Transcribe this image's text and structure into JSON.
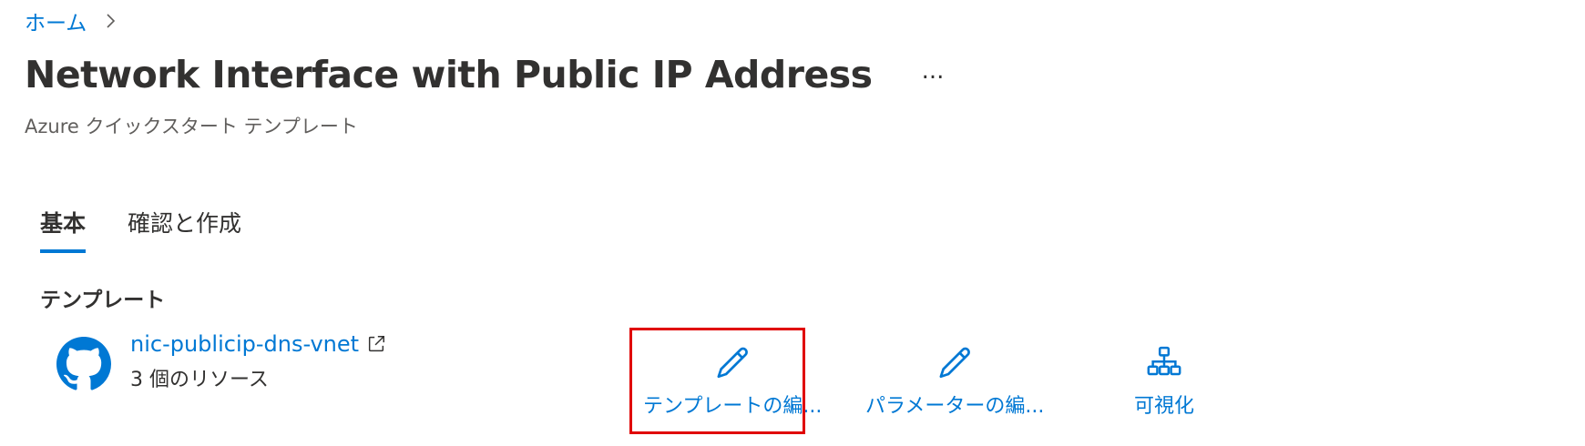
{
  "breadcrumb": {
    "home_label": "ホーム"
  },
  "header": {
    "title": "Network Interface with Public IP Address",
    "more_label": "...",
    "subtitle": "Azure クイックスタート テンプレート"
  },
  "tabs": [
    {
      "label": "基本",
      "active": true
    },
    {
      "label": "確認と作成",
      "active": false
    }
  ],
  "template_section": {
    "heading": "テンプレート",
    "repo_icon": "github-icon",
    "repo_name": "nic-publicip-dns-vnet",
    "resource_count": "3 個のリソース",
    "actions": [
      {
        "label": "テンプレートの編...",
        "icon": "pencil-icon",
        "highlighted": true
      },
      {
        "label": "パラメーターの編...",
        "icon": "pencil-icon",
        "highlighted": false
      },
      {
        "label": "可視化",
        "icon": "hierarchy-icon",
        "highlighted": false
      }
    ]
  },
  "colors": {
    "accent": "#0078d4",
    "text": "#323130",
    "secondary_text": "#605e5c",
    "highlight": "#e00000"
  }
}
